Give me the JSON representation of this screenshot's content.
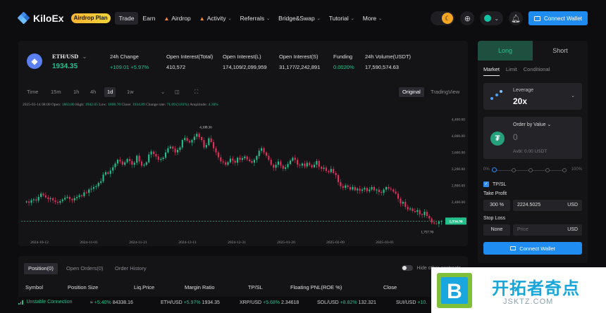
{
  "nav": {
    "brand": "KiloEx",
    "airdrop_pill": "Airdrop Plan",
    "items": [
      {
        "label": "Trade",
        "active": true,
        "hot": false,
        "dropdown": false
      },
      {
        "label": "Earn",
        "active": false,
        "hot": false,
        "dropdown": false
      },
      {
        "label": "Airdrop",
        "active": false,
        "hot": true,
        "dropdown": false
      },
      {
        "label": "Activity",
        "active": false,
        "hot": true,
        "dropdown": true
      },
      {
        "label": "Referrals",
        "active": false,
        "hot": false,
        "dropdown": true
      },
      {
        "label": "Bridge&Swap",
        "active": false,
        "hot": false,
        "dropdown": true
      },
      {
        "label": "Tutorial",
        "active": false,
        "hot": false,
        "dropdown": true
      },
      {
        "label": "More",
        "active": false,
        "hot": false,
        "dropdown": true
      }
    ],
    "connect_wallet": "Connect Wallet"
  },
  "ticker": {
    "pair": "ETH/USD",
    "price": "1934.35",
    "stats": [
      {
        "label": "24h Change",
        "value": "+109.01 +5.97%",
        "green": true
      },
      {
        "label": "Open Interest(Total)",
        "value": "410,572",
        "green": false
      },
      {
        "label": "Open Interest(L)",
        "value": "174,109/2,099,959",
        "green": false
      },
      {
        "label": "Open Interest(S)",
        "value": "31,177/2,242,891",
        "green": false
      },
      {
        "label": "Funding",
        "value": "0.0020%",
        "green": true
      },
      {
        "label": "24h Volume(USDT)",
        "value": "17,590,574.63",
        "green": false
      }
    ]
  },
  "timeframes": [
    "Time",
    "15m",
    "1h",
    "4h",
    "1d",
    "1w"
  ],
  "active_timeframe": "1d",
  "views": {
    "original": "Original",
    "tradingview": "TradingView"
  },
  "ohlc": {
    "date": "2025-03-14 08:00",
    "open_label": "Open:",
    "open": "1863.80",
    "high_label": "High:",
    "high": "1942.05",
    "low_label": "Low:",
    "low": "1800.70",
    "close_label": "Close:",
    "close": "1934.89",
    "change_label": "Change rate:",
    "change": "71.09 (3.81%)",
    "amp_label": "Amplitude:",
    "amp": "4.30%"
  },
  "chart_data": {
    "type": "candlestick",
    "y_ticks": [
      "4,400.00",
      "4,000.00",
      "3,600.00",
      "3,200.00",
      "2,800.00",
      "2,400.00",
      "2,000.00"
    ],
    "ylim": [
      1600,
      4600
    ],
    "x_ticks": [
      "2024-10-12",
      "2024-11-01",
      "2024-11-21",
      "2024-12-11",
      "2024-12-31",
      "2025-01-20",
      "2025-02-09",
      "2025-03-01"
    ],
    "max_label": "4,108.36",
    "min_label": "1,757.70",
    "last_price_label": "1,934.90",
    "last_price": 1934.9,
    "colors": {
      "up": "#22c08a",
      "down": "#e0305a"
    },
    "closes": [
      2410,
      2380,
      2440,
      2460,
      2430,
      2520,
      2600,
      2560,
      2510,
      2470,
      2490,
      2440,
      2400,
      2380,
      2420,
      2460,
      2500,
      2520,
      2470,
      2440,
      2490,
      2520,
      2560,
      2540,
      2630,
      2620,
      2700,
      2720,
      2760,
      2780,
      2860,
      2900,
      3060,
      3120,
      3080,
      3160,
      3240,
      3330,
      3420,
      3380,
      3300,
      3360,
      3440,
      3390,
      3300,
      3350,
      3520,
      3380,
      3280,
      3300,
      3360,
      3550,
      3620,
      3560,
      3500,
      3420,
      3440,
      3470,
      3600,
      3700,
      3740,
      3690,
      3600,
      3660,
      3720,
      3900,
      3950,
      3880,
      3840,
      3900,
      3980,
      4050,
      3970,
      3900,
      3720,
      3780,
      3940,
      3850,
      3700,
      3600,
      3480,
      3380,
      3360,
      3300,
      3360,
      3450,
      3400,
      3350,
      3470,
      3420,
      3460,
      3500,
      3430,
      3390,
      3350,
      3420,
      3510,
      3640,
      3700,
      3600,
      3520,
      3420,
      3300,
      3230,
      3300,
      3380,
      3280,
      3200,
      3240,
      3320,
      3400,
      3470,
      3420,
      3300,
      3280,
      3330,
      3260,
      3350,
      3290,
      3240,
      3300,
      3390,
      3250,
      3200,
      3230,
      3150,
      3120,
      3200,
      3100,
      3050,
      2880,
      2780,
      2740,
      2800,
      2760,
      2700,
      2760,
      2680,
      2720,
      2670,
      2700,
      2740,
      2660,
      2700,
      2760,
      2680,
      2700,
      2640,
      2620,
      2700,
      2760,
      2720,
      2700,
      2650,
      2600,
      2480,
      2360,
      2400,
      2280,
      2220,
      2240,
      2180,
      2160,
      2200,
      2100,
      2080,
      2160,
      2060,
      2000,
      1900,
      1880,
      1870,
      1920,
      1934.9
    ],
    "opens_offset_note": ""
  },
  "trade": {
    "long": "Long",
    "short": "Short",
    "order_types": [
      "Market",
      "Limit",
      "Conditional"
    ],
    "leverage_label": "Leverage",
    "leverage_value": "20x",
    "order_by_label": "Order by Value",
    "amount_placeholder": "0",
    "available": "Avbl: 0.00 USDT",
    "slider_marks": [
      "0%",
      "100%"
    ],
    "tpsl_label": "TP/SL",
    "take_profit_label": "Take Profit",
    "tp_percent": "300",
    "tp_percent_unit": "%",
    "tp_price": "2224.5025",
    "tp_unit": "USD",
    "stop_loss_label": "Stop Loss",
    "sl_percent": "None",
    "sl_price_placeholder": "Price",
    "sl_unit": "USD",
    "connect_wallet": "Connect Wallet"
  },
  "positions": {
    "tabs": [
      "Position(0)",
      "Open Orders(0)",
      "Order History"
    ],
    "hide_other": "Hide other contracts",
    "columns": [
      "Symbol",
      "Position Size",
      "Liq.Price",
      "Margin Ratio",
      "TP/SL",
      "Floating PNL(ROE %)",
      "Close"
    ]
  },
  "status": {
    "connection": "Unstable Connection",
    "tickers": [
      {
        "text": "≈",
        "change": "+5.40%",
        "price": "84338.16"
      },
      {
        "text": "ETH/USD",
        "change": "+5.97%",
        "price": "1934.35"
      },
      {
        "text": "XRP/USD",
        "change": "+5.68%",
        "price": "2.34618"
      },
      {
        "text": "SOL/USD",
        "change": "+8.82%",
        "price": "132.321"
      },
      {
        "text": "SUI/USD",
        "change": "+10.",
        "price": ""
      }
    ]
  },
  "watermark": {
    "title": "开拓者奇点",
    "url": "JSKTZ.COM"
  }
}
